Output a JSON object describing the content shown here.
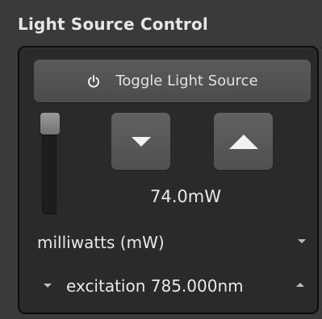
{
  "panel": {
    "title": "Light Source Control"
  },
  "toggle": {
    "label": "Toggle Light Source",
    "icon": "power-icon"
  },
  "power": {
    "value_text": "74.0mW",
    "decrease_icon": "triangle-down-icon",
    "increase_icon": "triangle-up-icon"
  },
  "unit": {
    "selected": "milliwatts (mW)"
  },
  "wavelength": {
    "label": "excitation 785.000nm"
  },
  "colors": {
    "background": "#3a3a3a",
    "frame": "#2a2a2a",
    "button": "#585858",
    "text": "#e8e8e8"
  }
}
